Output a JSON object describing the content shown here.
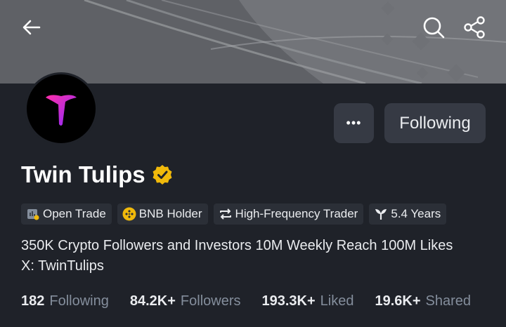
{
  "header": {
    "back_icon": "arrow-left-icon",
    "search_icon": "search-icon",
    "share_icon": "share-icon"
  },
  "profile": {
    "name": "Twin Tulips",
    "verified": true,
    "more_label": "•••",
    "follow_label": "Following",
    "accent_color": "#f0b90b"
  },
  "tags": [
    {
      "icon": "open-trade-icon",
      "label": "Open Trade"
    },
    {
      "icon": "bnb-icon",
      "label": "BNB Holder"
    },
    {
      "icon": "high-frequency-icon",
      "label": "High-Frequency Trader"
    },
    {
      "icon": "sprout-icon",
      "label": "5.4 Years"
    }
  ],
  "bio": {
    "line1": "350K Crypto Followers and Investors 10M Weekly Reach 100M Likes",
    "line2": "X: TwinTulips"
  },
  "stats": [
    {
      "value": "182",
      "label": "Following"
    },
    {
      "value": "84.2K+",
      "label": "Followers"
    },
    {
      "value": "193.3K+",
      "label": "Liked"
    },
    {
      "value": "19.6K+",
      "label": "Shared"
    }
  ]
}
